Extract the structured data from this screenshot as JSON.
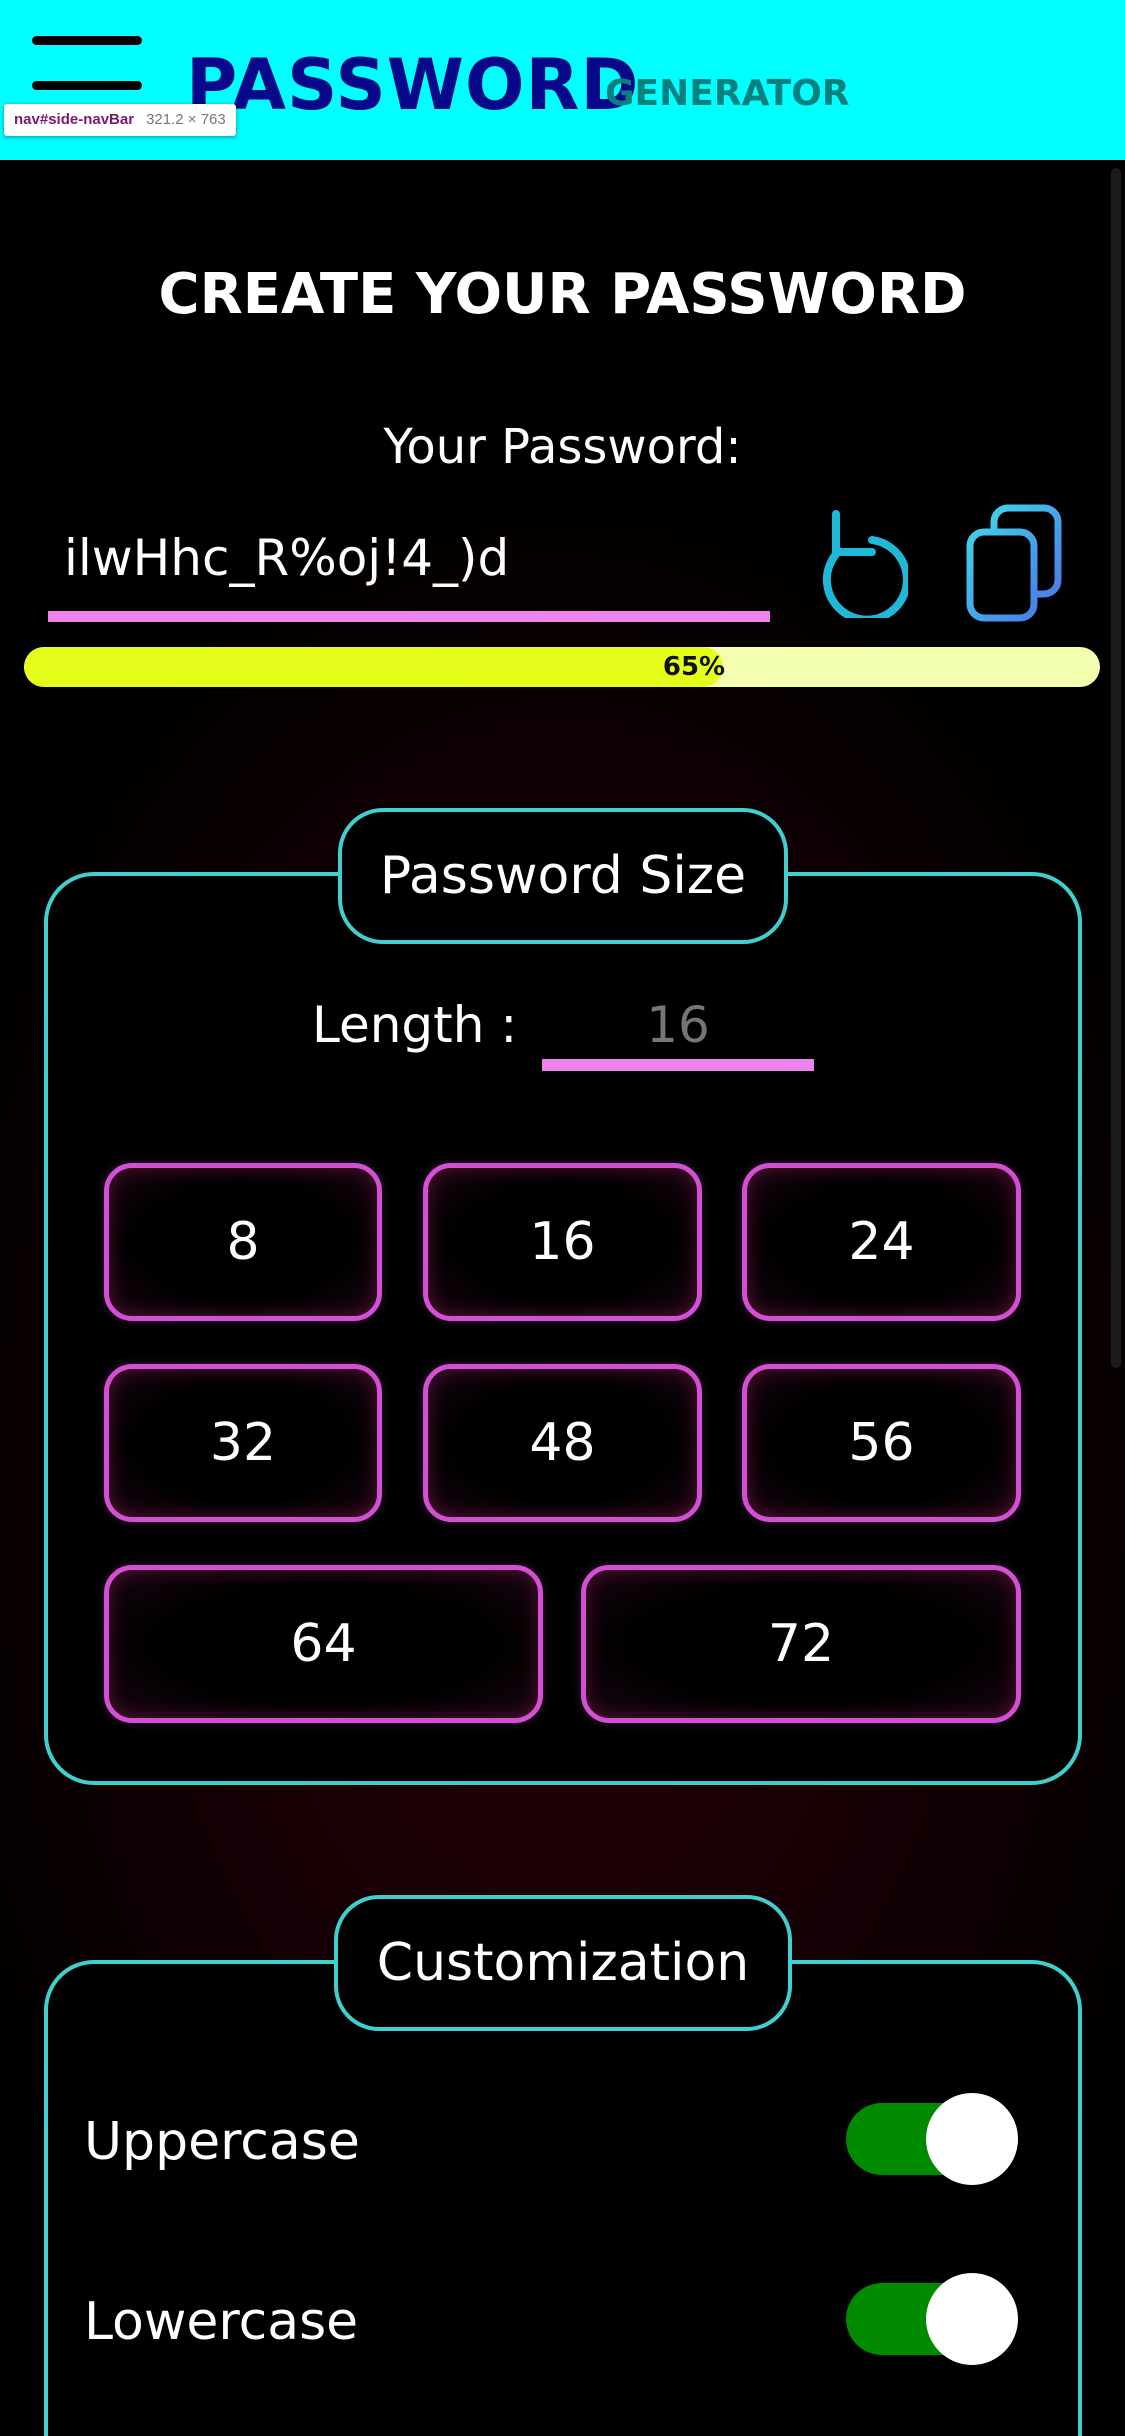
{
  "header": {
    "brand_main": "PASSWORD",
    "brand_sub": "GENERATOR",
    "menu_icon": "hamburger-icon",
    "inspector_tip": {
      "selector": "nav#side-navBar",
      "size": "321.2 × 763"
    },
    "background_color": "#00ffff"
  },
  "main": {
    "title": "CREATE YOUR PASSWORD",
    "password_label": "Your Password:",
    "password_value": "ilwHhc_R%oj!4_)d",
    "refresh_icon": "refresh-icon",
    "copy_icon": "copy-icon",
    "strength": {
      "value": 0.65,
      "text": "65%"
    }
  },
  "size_section": {
    "label": "Password Size",
    "length_label": "Length :",
    "length_placeholder": "16",
    "options": [
      "8",
      "16",
      "24",
      "32",
      "48",
      "56",
      "64",
      "72"
    ]
  },
  "custom_section": {
    "label": "Customization",
    "toggles": [
      {
        "label": "Uppercase",
        "on": true
      },
      {
        "label": "Lowercase",
        "on": true
      }
    ]
  },
  "colors": {
    "header": "#00ffff",
    "brand": "#08088a",
    "accent_border": "#3fcfcf",
    "button_border": "#d34fd3",
    "underline": "#ee82ee",
    "progress_fill": "#e6ff1a",
    "toggle_on": "#008a00"
  }
}
